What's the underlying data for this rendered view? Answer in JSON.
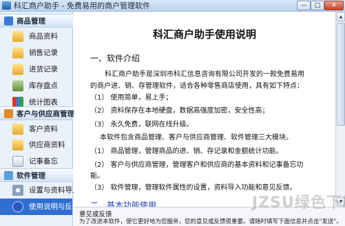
{
  "window": {
    "title": "科汇商户助手 - 免费易用的商户管理软件",
    "min_symbol": "—",
    "max_symbol": "□",
    "close_symbol": "✕"
  },
  "sidebar": {
    "groups": [
      {
        "label": "商品管理",
        "items": [
          {
            "label": "商品资料",
            "icon": "folder-icon"
          },
          {
            "label": "销售记录",
            "icon": "folder-icon"
          },
          {
            "label": "进货记录",
            "icon": "folder-icon"
          },
          {
            "label": "库存盘点",
            "icon": "warehouse-icon"
          },
          {
            "label": "统计图表",
            "icon": "chart-icon"
          }
        ]
      },
      {
        "label": "客户与供应商管理",
        "items": [
          {
            "label": "客户资料",
            "icon": "folder-icon"
          },
          {
            "label": "供应商资料",
            "icon": "folder-icon"
          },
          {
            "label": "记事备忘",
            "icon": "notepad-icon"
          }
        ]
      },
      {
        "label": "软件管理",
        "items": [
          {
            "label": "设置与资料导入",
            "icon": "settings-icon"
          },
          {
            "label": "使用说明与反馈",
            "icon": "help-icon",
            "active": true
          }
        ]
      }
    ]
  },
  "doc": {
    "title": "科汇商户助手使用说明",
    "section1": "一、软件介绍",
    "intro_line1": "科汇商户助手是深圳市科汇信息咨询有限公司开发的一款免费易用",
    "intro_line2": "的商户进、销、存管理软件，适合各种零售商店使用，具有如下特点：",
    "f1": "（1）  使用简单，易上手；",
    "f2": "（2）  资料保存在本地硬盘，数据高强度加密，安全性高；",
    "f3": "（3）  永久免费，联网在线升级。",
    "m0": "本软件包含商品管理、客户与供应商管理、软件管理三大模块。",
    "m1": "（1）  商品管理，管理商品的进、销、存记录和金额统计功能。",
    "m2a": "（2）  客户与供应商管理，管理客户和供应商的基本资料和记事备忘功",
    "m2b": "能。",
    "m3": "（3）  软件管理，管理软件属性的设置，资料导入功能和意见反馈。",
    "section2": "二、基本功能使用"
  },
  "scrollbar": {
    "up": "▲",
    "down": "▼"
  },
  "hint": {
    "title": "意见或反馈",
    "desc": "为了改进本软件，使它更好地为您服务，您的意见或反馈很重要。请随时填写下面信息并点击\"发送\"。"
  },
  "watermark": "JZSU绿色下载"
}
